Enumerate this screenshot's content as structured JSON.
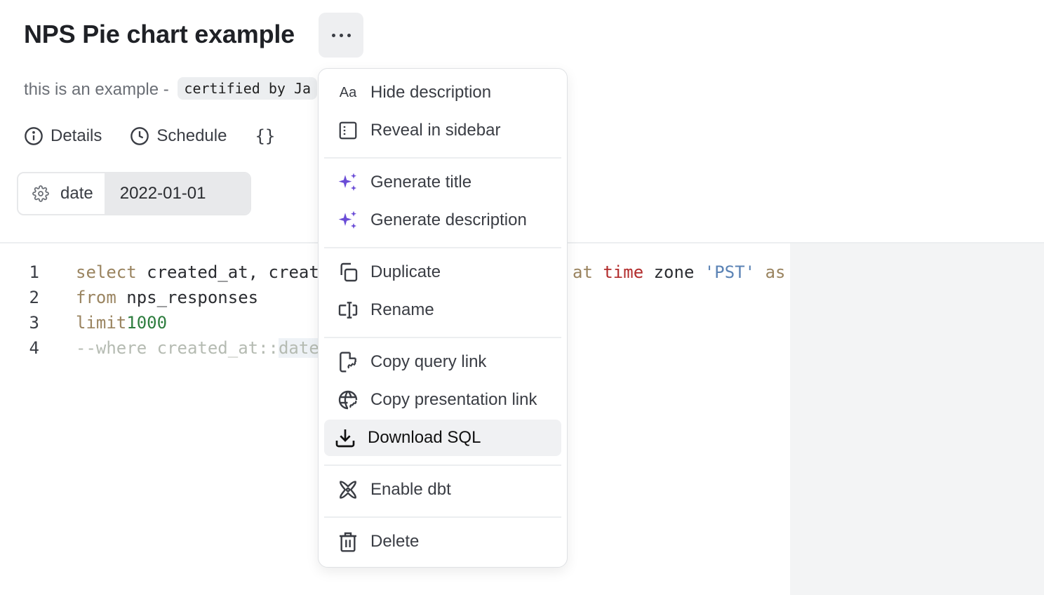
{
  "header": {
    "title": "NPS Pie chart example",
    "more_icon": "ellipsis-icon"
  },
  "description": {
    "text": "this is an example - ",
    "badge": "certified by Ja"
  },
  "tabs": [
    {
      "label": "Details",
      "icon": "info-icon"
    },
    {
      "label": "Schedule",
      "icon": "clock-icon"
    },
    {
      "label": "{}",
      "icon": "braces-icon"
    }
  ],
  "parameter": {
    "name": "date",
    "value": "2022-01-01",
    "icon": "gear-icon"
  },
  "editor": {
    "line_numbers": [
      "1",
      "2",
      "3",
      "4"
    ],
    "line1": {
      "kw_select": "select",
      "text1": " created_at, creat",
      "kw_at": "at",
      "kw_time": "time",
      "text2": " zone ",
      "str": "'PST'",
      "kw_as": "as"
    },
    "line2": {
      "kw_from": "from",
      "text": " nps_responses"
    },
    "line3": {
      "kw_limit": "limit",
      "num": "1000"
    },
    "line4": {
      "comment": "--where created_at::",
      "comment_hl": "date"
    }
  },
  "menu": {
    "items": [
      {
        "label": "Hide description",
        "icon": "text-aa-icon"
      },
      {
        "label": "Reveal in sidebar",
        "icon": "sidebar-icon"
      },
      {
        "label": "Generate title",
        "icon": "sparkles-icon"
      },
      {
        "label": "Generate description",
        "icon": "sparkles-icon"
      },
      {
        "label": "Duplicate",
        "icon": "copy-icon"
      },
      {
        "label": "Rename",
        "icon": "text-cursor-icon"
      },
      {
        "label": "Copy query link",
        "icon": "file-link-icon"
      },
      {
        "label": "Copy presentation link",
        "icon": "globe-link-icon"
      },
      {
        "label": "Download SQL",
        "icon": "download-icon"
      },
      {
        "label": "Enable dbt",
        "icon": "dbt-icon"
      },
      {
        "label": "Delete",
        "icon": "trash-icon"
      }
    ]
  },
  "colors": {
    "accent_sparkle": "#6a4cd6",
    "active_item_bg": "#f0f1f3"
  }
}
